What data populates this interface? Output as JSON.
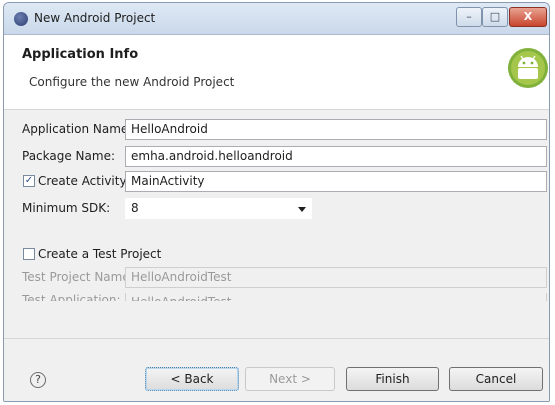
{
  "window": {
    "title": "New Android Project",
    "minimize_glyph": "–",
    "maximize_glyph": "□",
    "close_glyph": "X"
  },
  "header": {
    "title": "Application Info",
    "subtitle": "Configure the new Android Project",
    "logo_icon": "android-logo-icon"
  },
  "form": {
    "application_name": {
      "label": "Application Name:",
      "value": "HelloAndroid"
    },
    "package_name": {
      "label": "Package Name:",
      "value": "emha.android.helloandroid"
    },
    "create_activity": {
      "label": "Create Activity:",
      "checked": true,
      "check_glyph": "✓",
      "value": "MainActivity"
    },
    "minimum_sdk": {
      "label": "Minimum SDK:",
      "value": "8"
    },
    "create_test_project": {
      "label": "Create a Test Project",
      "checked": false
    },
    "test_project_name": {
      "label": "Test Project Name:",
      "value": "HelloAndroidTest"
    },
    "test_application": {
      "label": "Test Application:",
      "value": "HelloAndroidTest"
    }
  },
  "footer": {
    "help_glyph": "?",
    "back": "< Back",
    "next": "Next >",
    "finish": "Finish",
    "cancel": "Cancel"
  }
}
